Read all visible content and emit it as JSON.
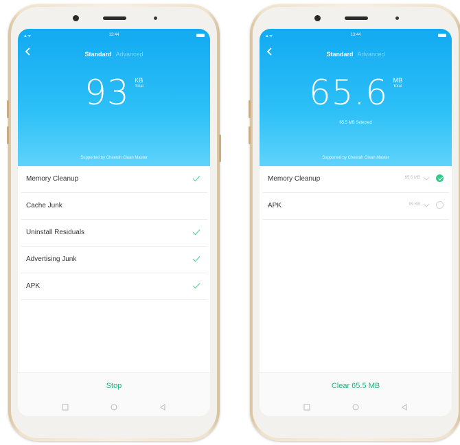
{
  "left_screen": {
    "status_time": "13:44",
    "tabs": {
      "active": "Standard",
      "inactive": "Advanced"
    },
    "value": "93",
    "unit": "KB",
    "unit_sub": "Total",
    "support_text": "Supported by Cheetah Clean Master",
    "items": [
      {
        "label": "Memory Cleanup",
        "checked": true
      },
      {
        "label": "Cache Junk",
        "checked": false
      },
      {
        "label": "Uninstall Residuals",
        "checked": true
      },
      {
        "label": "Advertising Junk",
        "checked": true
      },
      {
        "label": "APK",
        "checked": true
      }
    ],
    "button_label": "Stop"
  },
  "right_screen": {
    "status_time": "13:44",
    "tabs": {
      "active": "Standard",
      "inactive": "Advanced"
    },
    "value": "65.6",
    "unit": "MB",
    "unit_sub": "Total",
    "selected_text": "65.5 MB Selected",
    "support_text": "Supported by Cheetah Clean Master",
    "items": [
      {
        "label": "Memory Cleanup",
        "size": "65.5 MB",
        "selected": true
      },
      {
        "label": "APK",
        "size": "99 KB",
        "selected": false
      }
    ],
    "button_label": "Clear 65.5 MB"
  },
  "colors": {
    "accent_blue": "#12aaf2",
    "accent_green": "#22b07d",
    "check_green": "#2ecc87"
  }
}
